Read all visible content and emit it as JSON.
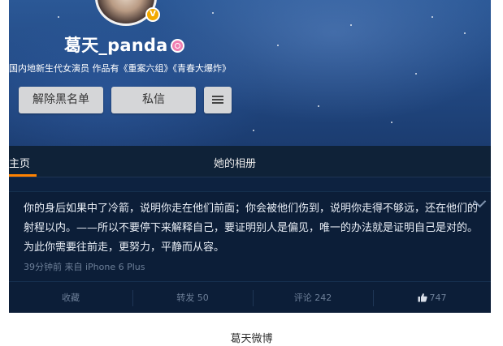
{
  "profile": {
    "name": "葛天_panda",
    "bio": "国内地新生代女演员 作品有《重案六组》《青春大爆炸》",
    "verified_icon": "verified-v-icon",
    "gender_icon": "female-icon"
  },
  "buttons": {
    "unblock": "解除黑名单",
    "message": "私信",
    "menu_icon": "hamburger-menu-icon"
  },
  "tabs": [
    {
      "label": "主页",
      "active": true
    },
    {
      "label": "她的相册",
      "active": false
    }
  ],
  "post": {
    "text": "你的身后如果中了冷箭，说明你走在他们前面；你会被他们伤到，说明你走得不够远，还在他们的射程以内。——所以不要停下来解释自己，要证明别人是偏见，唯一的办法就是证明自己是对的。 为此你需要往前走，更努力，平静而从容。",
    "meta": "39分钟前 来自 iPhone 6 Plus",
    "actions": {
      "favorite": "收藏",
      "repost": "转发 50",
      "comment": "评论 242",
      "like": "747"
    }
  },
  "caption": "葛天微博",
  "colors": {
    "accent": "#ff8200",
    "hero_top": "#2b5896",
    "dark_bg": "#0d2240"
  }
}
